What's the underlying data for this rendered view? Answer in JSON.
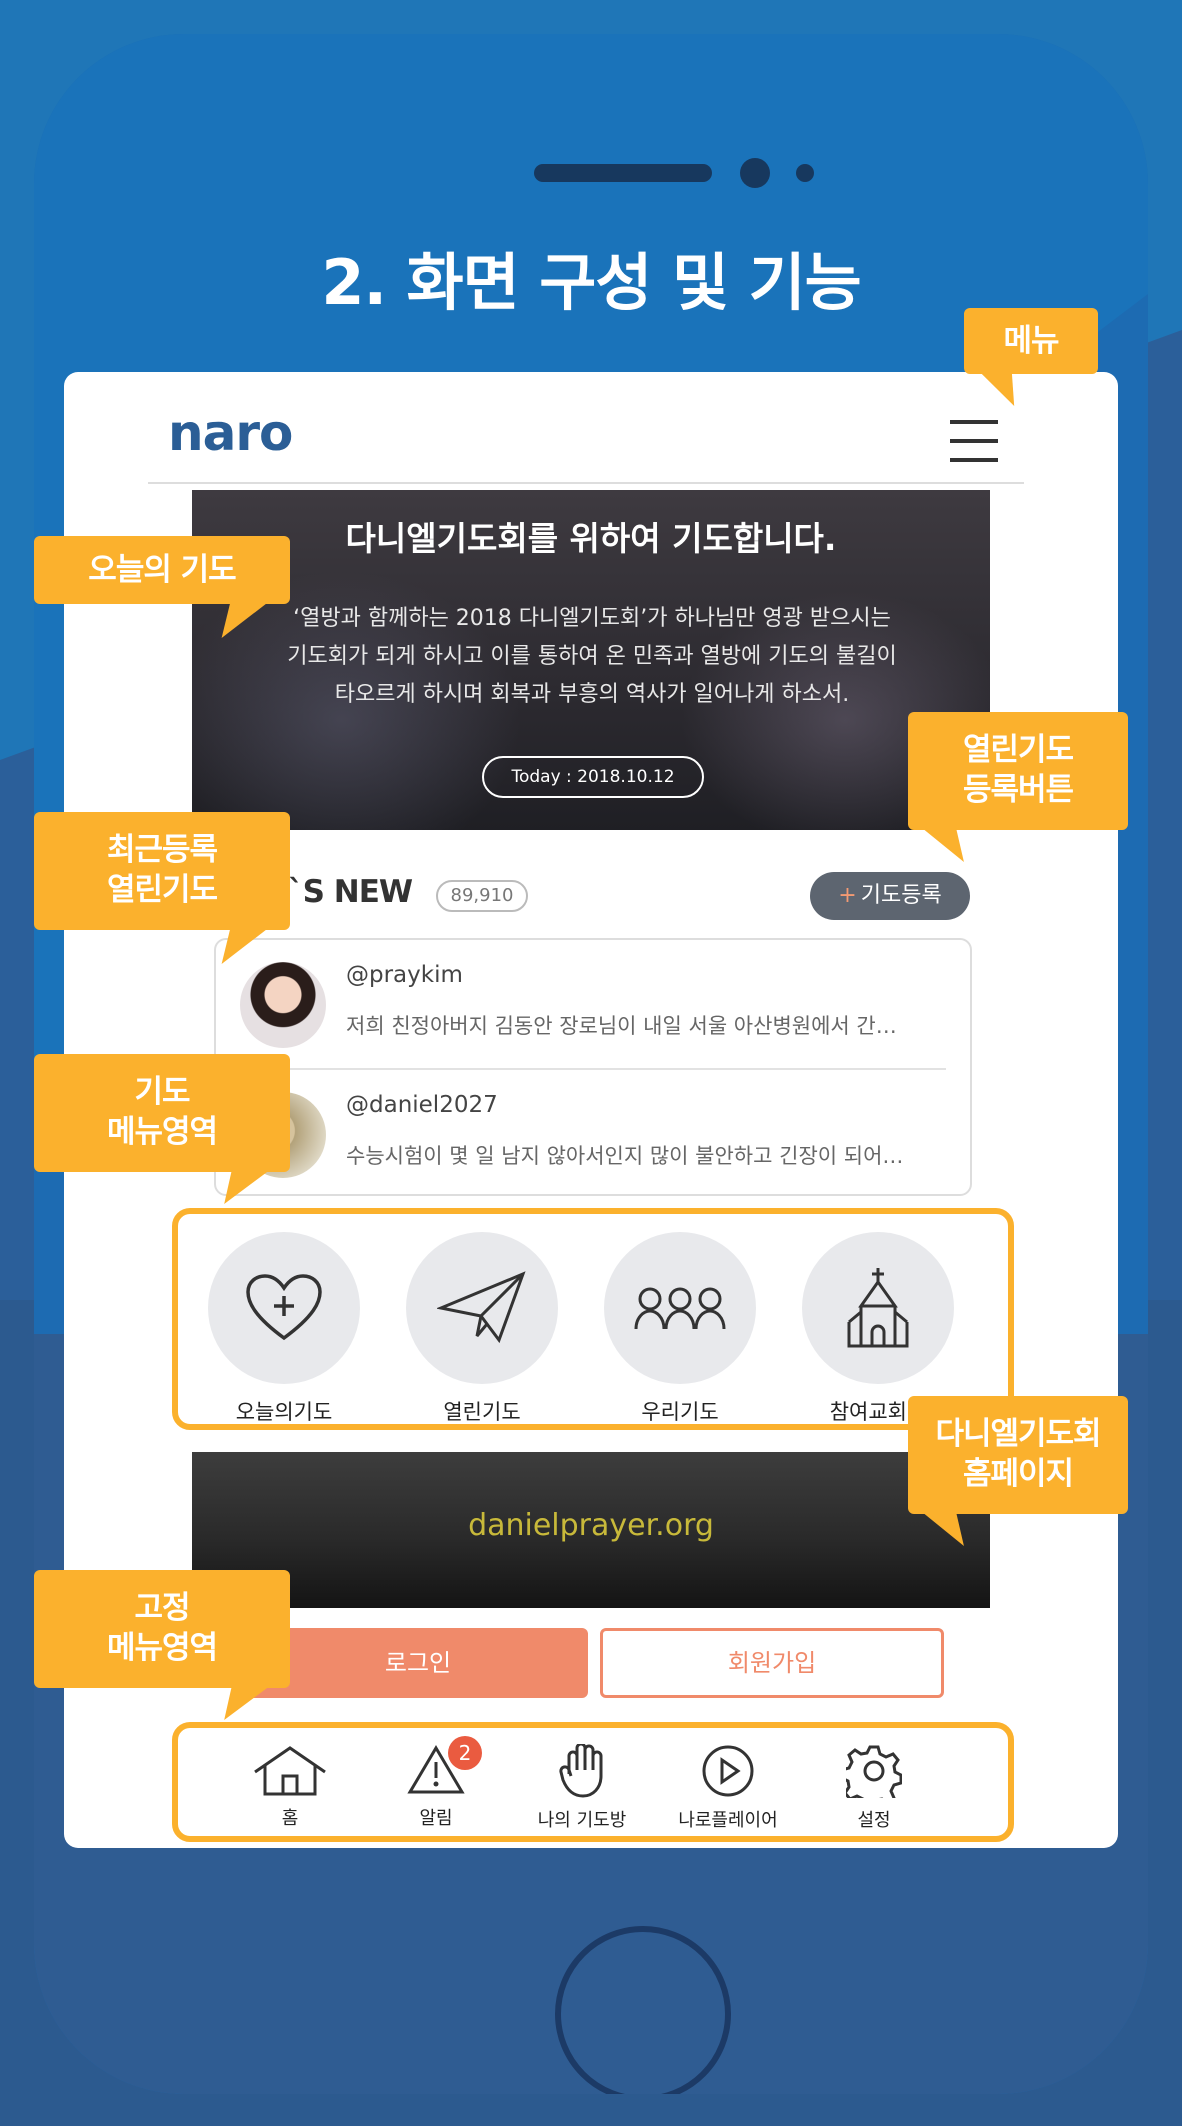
{
  "page_title": "2. 화면 구성 및 기능",
  "app": {
    "logo": "naro",
    "hero": {
      "title": "다니엘기도회를 위하여 기도합니다.",
      "body_line1": "‘열방과 함께하는 2018 다니엘기도회’가 하나님만 영광 받으시는",
      "body_line2": "기도회가 되게 하시고 이를 통하여 온 민족과 열방에 기도의 불길이",
      "body_line3": "타오르게 하시며 회복과 부흥의 역사가 일어나게 하소서.",
      "date": "Today : 2018.10.12"
    },
    "whats_new": {
      "label": "T`S NEW",
      "count": "89,910",
      "register_button": "기도등록",
      "items": [
        {
          "name": "@praykim",
          "text": "저희 친정아버지 김동안 장로님이 내일 서울 아산병원에서 간…"
        },
        {
          "name": "@daniel2027",
          "text": "수능시험이 몇 일 남지 않아서인지 많이 불안하고 긴장이 되어…"
        }
      ]
    },
    "prayer_menu": [
      {
        "label": "오늘의기도",
        "icon": "heart-cross-icon"
      },
      {
        "label": "열린기도",
        "icon": "paper-plane-icon"
      },
      {
        "label": "우리기도",
        "icon": "group-icon"
      },
      {
        "label": "참여교회안",
        "icon": "church-icon"
      }
    ],
    "banner": {
      "text": "danielprayer.org"
    },
    "login_button": "로그인",
    "join_button": "회원가입",
    "tabbar": [
      {
        "label": "홈",
        "icon": "home-icon"
      },
      {
        "label": "알림",
        "icon": "alert-icon",
        "badge": "2"
      },
      {
        "label": "나의 기도방",
        "icon": "hand-icon"
      },
      {
        "label": "나로플레이어",
        "icon": "play-icon"
      },
      {
        "label": "설정",
        "icon": "gear-icon"
      }
    ]
  },
  "callouts": {
    "menu": "메뉴",
    "today_prayer": "오늘의 기도",
    "open_prayer_register_1": "열린기도",
    "open_prayer_register_2": "등록버튼",
    "recent_open_1": "최근등록",
    "recent_open_2": "열린기도",
    "prayer_menu_1": "기도",
    "prayer_menu_2": "메뉴영역",
    "homepage_1": "다니엘기도회",
    "homepage_2": "홈페이지",
    "fixed_menu_1": "고정",
    "fixed_menu_2": "메뉴영역"
  },
  "colors": {
    "accent": "#fbb12d",
    "primary": "#2b5e96",
    "login": "#f08a6a",
    "badge": "#ea5b40"
  }
}
